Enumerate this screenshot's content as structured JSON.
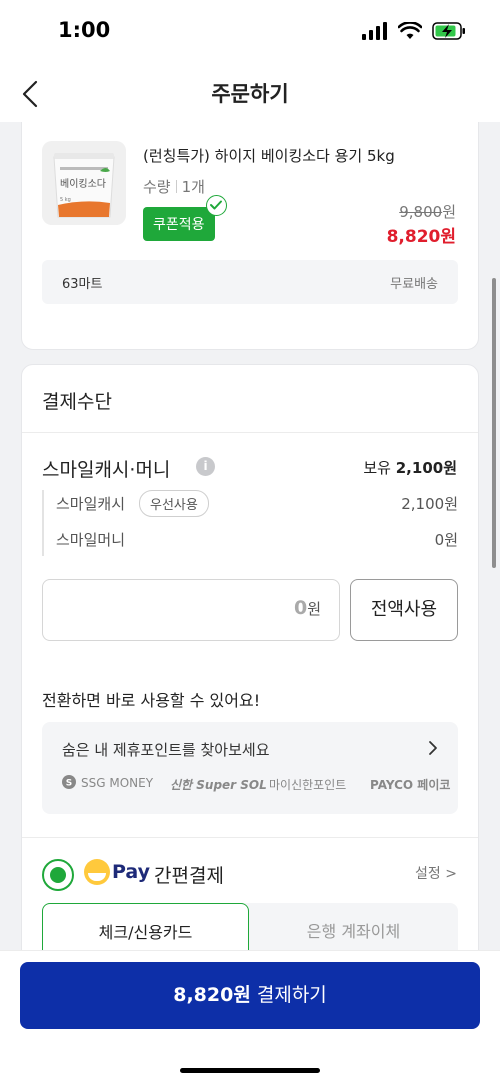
{
  "status_bar": {
    "time": "1:00"
  },
  "nav": {
    "title": "주문하기"
  },
  "product": {
    "name": "(런칭특가) 하이지 베이킹소다 용기 5kg",
    "qty_label": "수량",
    "qty_value": "1개",
    "coupon_label": "쿠폰적용",
    "original_price": "9,800",
    "original_unit": "원",
    "sale_price": "8,820원",
    "seller": "63마트",
    "shipping": "무료배송",
    "image_text_1": "베이킹소다",
    "image_text_2": "5 kg"
  },
  "payment": {
    "section_title": "결제수단",
    "smile_title": "스마일캐시·머니",
    "info_glyph": "i",
    "holding_label": "보유",
    "holding_amount": "2,100원",
    "cash_label": "스마일캐시",
    "cash_pill": "우선사용",
    "cash_value": "2,100원",
    "money_label": "스마일머니",
    "money_value": "0원",
    "input_value": "0",
    "input_unit": "원",
    "use_all_button": "전액사용",
    "convert_text": "전환하면 바로 사용할 수 있어요!",
    "promo_text": "숨은 내 제휴포인트를 찾아보세요",
    "brands": [
      "SSG MONEY",
      "신한 Super SOL",
      "마이신한포인트",
      "PAYCO 페이코"
    ],
    "easy_pay_brand": "Pay",
    "easy_pay_label": "간편결제",
    "settings_label": "설정 >",
    "tab_card": "체크/신용카드",
    "tab_bank": "은행 계좌이체"
  },
  "checkout": {
    "amount": "8,820원",
    "label": "결제하기"
  },
  "colors": {
    "accent_green": "#1fa83a",
    "sale_red": "#e01e2d",
    "primary_blue": "#0d2fa8"
  }
}
